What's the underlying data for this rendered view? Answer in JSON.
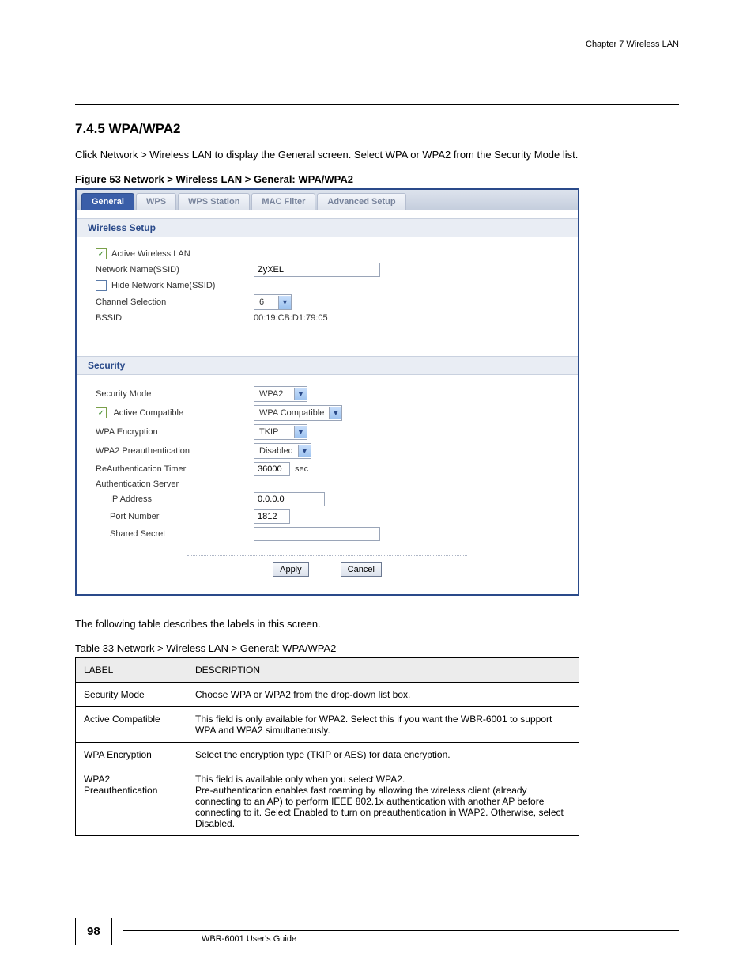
{
  "chapter_header": "Chapter 7 Wireless LAN",
  "section_title": "7.4.5  WPA/WPA2",
  "intro_text": "Click Network > Wireless LAN to display the General screen. Select WPA or WPA2 from the Security Mode list.",
  "figure_caption": "Figure 53   Network > Wireless LAN > General: WPA/WPA2",
  "tabs": [
    {
      "label": "General",
      "name": "tab-general",
      "active": true
    },
    {
      "label": "WPS",
      "name": "tab-wps",
      "active": false
    },
    {
      "label": "WPS Station",
      "name": "tab-wps-station",
      "active": false
    },
    {
      "label": "MAC Filter",
      "name": "tab-mac-filter",
      "active": false
    },
    {
      "label": "Advanced Setup",
      "name": "tab-advanced",
      "active": false
    }
  ],
  "wireless_setup": {
    "header": "Wireless Setup",
    "active_label": "Active Wireless LAN",
    "active_checked": true,
    "ssid_label": "Network Name(SSID)",
    "ssid_value": "ZyXEL",
    "hide_label": "Hide Network Name(SSID)",
    "hide_checked": false,
    "channel_label": "Channel Selection",
    "channel_value": "6",
    "bssid_label": "BSSID",
    "bssid_value": "00:19:CB:D1:79:05"
  },
  "security": {
    "header": "Security",
    "mode_label": "Security Mode",
    "mode_value": "WPA2",
    "active_compat_label": "Active Compatible",
    "active_compat_checked": true,
    "compat_value": "WPA Compatible",
    "encryption_label": "WPA Encryption",
    "encryption_value": "TKIP",
    "preauth_label": "WPA2 Preauthentication",
    "preauth_value": "Disabled",
    "reauth_label": "ReAuthentication Timer",
    "reauth_value": "36000",
    "reauth_unit": "sec",
    "auth_server_label": "Authentication Server",
    "ip_label": "IP Address",
    "ip_value": "0.0.0.0",
    "port_label": "Port Number",
    "port_value": "1812",
    "secret_label": "Shared Secret",
    "secret_value": ""
  },
  "buttons": {
    "apply": "Apply",
    "cancel": "Cancel"
  },
  "table": {
    "intro": "The following table describes the labels in this screen.",
    "caption": "Table 33   Network > Wireless LAN > General: WPA/WPA2",
    "header_label": "LABEL",
    "header_desc": "DESCRIPTION",
    "rows": [
      {
        "label": "Security Mode",
        "desc": "Choose WPA or WPA2 from the drop-down list box."
      },
      {
        "label": "Active Compatible",
        "desc": "This field is only available for WPA2. Select this if you want the WBR-6001 to support WPA and WPA2 simultaneously."
      },
      {
        "label": "WPA Encryption",
        "desc": "Select the encryption type (TKIP or AES) for data encryption."
      },
      {
        "label": "WPA2 Preauthentication",
        "desc": "This field is available only when you select WPA2.\nPre-authentication enables fast roaming by allowing the wireless client (already connecting to an AP) to perform IEEE 802.1x authentication with another AP before connecting to it. Select Enabled to turn on preauthentication in WAP2. Otherwise, select Disabled."
      }
    ]
  },
  "page_number": "98",
  "footer_text": "WBR-6001 User's Guide"
}
